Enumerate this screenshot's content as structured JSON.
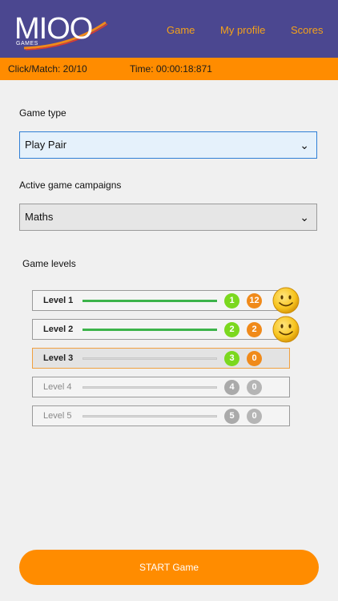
{
  "app": {
    "logo_text": "MIOO",
    "logo_sub": "GAMES"
  },
  "nav": [
    {
      "label": "Game"
    },
    {
      "label": "My profile"
    },
    {
      "label": "Scores"
    }
  ],
  "status": {
    "clicks": "Click/Match: 20/10",
    "time": "Time: 00:00:18:871"
  },
  "form": {
    "game_type_label": "Game type",
    "game_type_value": "Play Pair",
    "campaigns_label": "Active game campaigns",
    "campaigns_value": "Maths"
  },
  "levels_label": "Game levels",
  "levels": [
    {
      "name": "Level 1",
      "num": "1",
      "count": "12",
      "state": "completed",
      "progress": 1
    },
    {
      "name": "Level 2",
      "num": "2",
      "count": "2",
      "state": "completed",
      "progress": 1
    },
    {
      "name": "Level 3",
      "num": "3",
      "count": "0",
      "state": "current",
      "progress": 0
    },
    {
      "name": "Level 4",
      "num": "4",
      "count": "0",
      "state": "locked",
      "progress": 0
    },
    {
      "name": "Level 5",
      "num": "5",
      "count": "0",
      "state": "locked",
      "progress": 0
    }
  ],
  "start_label": "START Game",
  "colors": {
    "header": "#4b4790",
    "accent": "#ff8c00",
    "nav": "#f4a11a",
    "green": "#7bd81e"
  }
}
